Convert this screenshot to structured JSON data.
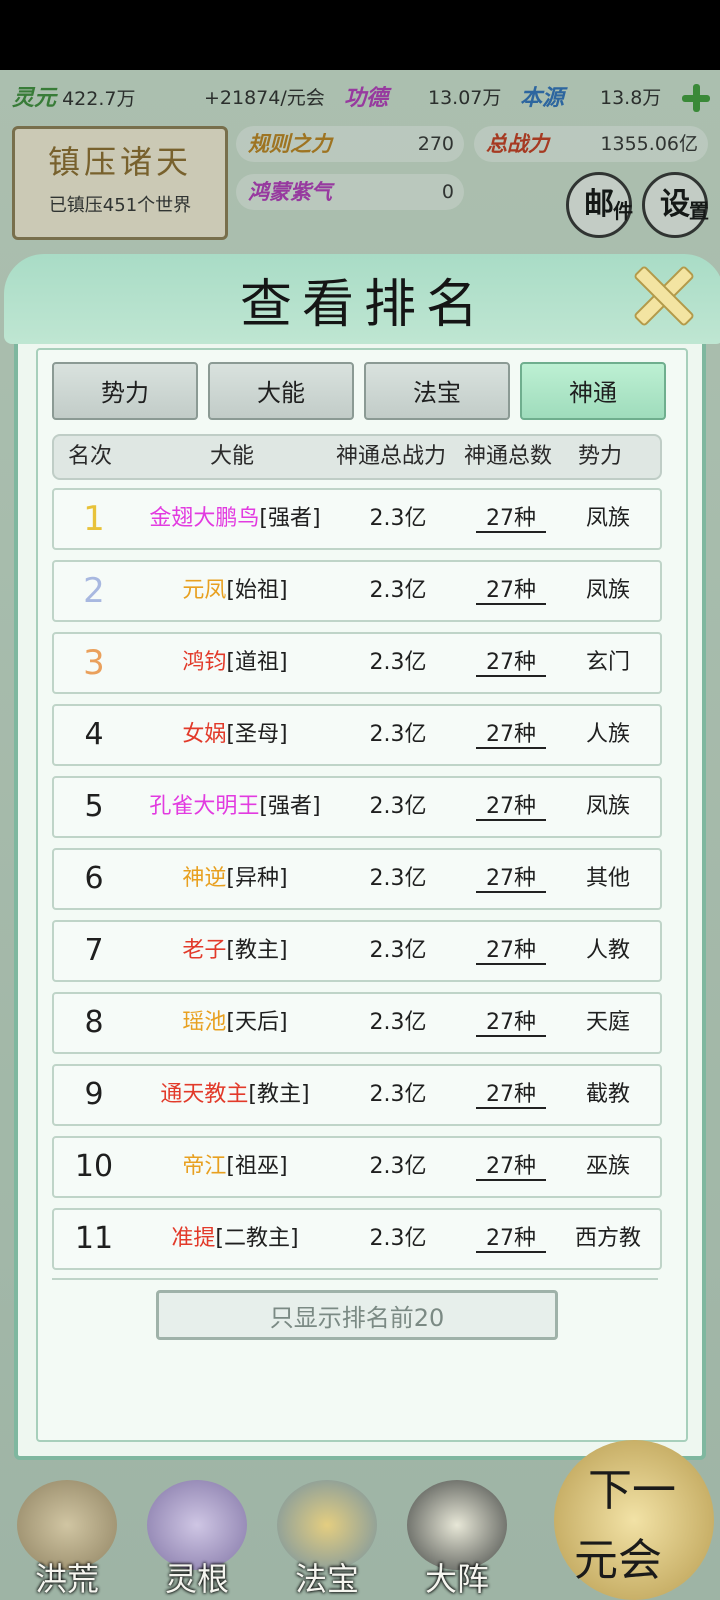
{
  "resources": {
    "lingyuan_label": "灵元",
    "lingyuan_value": "422.7万",
    "rate": "+21874/元会",
    "gongde_label": "功德",
    "gongde_value": "13.07万",
    "benyuan_label": "本源",
    "benyuan_value": "13.8万"
  },
  "world": {
    "title": "镇压诸天",
    "subtitle": "已镇压451个世界"
  },
  "stats": {
    "rules_label": "规则之力",
    "rules_value": "270",
    "power_label": "总战力",
    "power_value": "1355.06亿",
    "hongmeng_label": "鸿蒙紫气",
    "hongmeng_value": "0"
  },
  "buttons": {
    "mail": "邮",
    "mail_sub": "件",
    "settings": "设",
    "settings_sub": "置"
  },
  "modal": {
    "title": "查看排名",
    "tabs": [
      "势力",
      "大能",
      "法宝",
      "神通"
    ],
    "active_tab": "神通",
    "columns": [
      "名次",
      "大能",
      "神通总战力",
      "神通总数",
      "势力"
    ],
    "rows": [
      {
        "rank": "1",
        "name": "金翅大鹏鸟",
        "title": "[强者]",
        "name_color": "#e23be0",
        "power": "2.3亿",
        "count": "27种",
        "faction": "凤族"
      },
      {
        "rank": "2",
        "name": "元凤",
        "title": "[始祖]",
        "name_color": "#e8a020",
        "power": "2.3亿",
        "count": "27种",
        "faction": "凤族"
      },
      {
        "rank": "3",
        "name": "鸿钧",
        "title": "[道祖]",
        "name_color": "#e23a2a",
        "power": "2.3亿",
        "count": "27种",
        "faction": "玄门"
      },
      {
        "rank": "4",
        "name": "女娲",
        "title": "[圣母]",
        "name_color": "#e23a2a",
        "power": "2.3亿",
        "count": "27种",
        "faction": "人族"
      },
      {
        "rank": "5",
        "name": "孔雀大明王",
        "title": "[强者]",
        "name_color": "#e23be0",
        "power": "2.3亿",
        "count": "27种",
        "faction": "凤族"
      },
      {
        "rank": "6",
        "name": "神逆",
        "title": "[异种]",
        "name_color": "#e8a020",
        "power": "2.3亿",
        "count": "27种",
        "faction": "其他"
      },
      {
        "rank": "7",
        "name": "老子",
        "title": "[教主]",
        "name_color": "#e23a2a",
        "power": "2.3亿",
        "count": "27种",
        "faction": "人教"
      },
      {
        "rank": "8",
        "name": "瑶池",
        "title": "[天后]",
        "name_color": "#e8a020",
        "power": "2.3亿",
        "count": "27种",
        "faction": "天庭"
      },
      {
        "rank": "9",
        "name": "通天教主",
        "title": "[教主]",
        "name_color": "#e23a2a",
        "power": "2.3亿",
        "count": "27种",
        "faction": "截教"
      },
      {
        "rank": "10",
        "name": "帝江",
        "title": "[祖巫]",
        "name_color": "#e8a020",
        "power": "2.3亿",
        "count": "27种",
        "faction": "巫族"
      },
      {
        "rank": "11",
        "name": "准提",
        "title": "[二教主]",
        "name_color": "#e23a2a",
        "power": "2.3亿",
        "count": "27种",
        "faction": "西方教"
      }
    ],
    "footer_button": "只显示排名前20"
  },
  "bottom_nav": {
    "items": [
      "洪荒",
      "灵根",
      "法宝",
      "大阵"
    ],
    "next_line1": "下一",
    "next_line2": "元会"
  }
}
